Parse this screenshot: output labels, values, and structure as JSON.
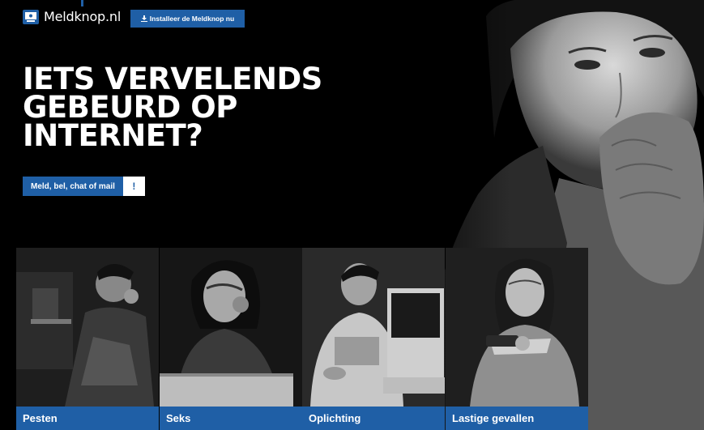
{
  "brand": {
    "name": "Meldknop.nl",
    "accent": "#1f5fa6"
  },
  "header": {
    "install_label": "Installeer de Meldknop nu",
    "install_icon": "download-icon"
  },
  "hero": {
    "headline_lines": [
      "IETS VERVELENDS",
      "GEBEURD OP",
      "INTERNET?"
    ]
  },
  "cta": {
    "label": "Meld, bel, chat of mail",
    "alert_symbol": "!"
  },
  "categories": [
    {
      "label": "Pesten"
    },
    {
      "label": "Seks"
    },
    {
      "label": "Oplichting"
    },
    {
      "label": "Lastige gevallen"
    }
  ]
}
